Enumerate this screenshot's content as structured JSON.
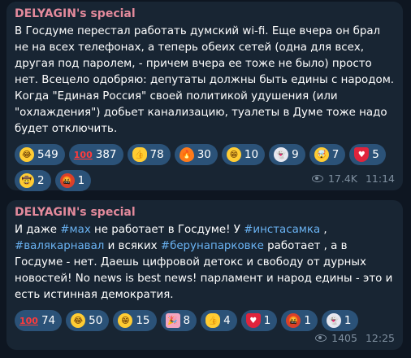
{
  "posts": [
    {
      "channel": "DELYAGIN's special",
      "text": "В Госдуме перестал работать думский wi-fi. Еще вчера он брал не на всех телефонах, а теперь обеих сетей (одна для всех, другая под паролем, - причем вчера ее тоже не было) просто нет. Всецело одобряю: депутаты должны быть едины с народом. Когда \"Единая Россия\" своей политикой удушения (или \"охлаждения\") добьет канализацию, туалеты в Думе тоже надо будет отключить.",
      "reactions": [
        {
          "icon": "rofl-emoji-icon",
          "count": "549"
        },
        {
          "icon": "hundred-emoji-icon",
          "count": "387"
        },
        {
          "icon": "thumbs-up-emoji-icon",
          "count": "78"
        },
        {
          "icon": "fire-emoji-icon",
          "count": "30"
        },
        {
          "icon": "grin-emoji-icon",
          "count": "10"
        },
        {
          "icon": "ghost-emoji-icon",
          "count": "9"
        },
        {
          "icon": "exploding-head-emoji-icon",
          "count": "7"
        },
        {
          "icon": "heart-emoji-icon",
          "count": "5"
        },
        {
          "icon": "cowboy-emoji-icon",
          "count": "2"
        },
        {
          "icon": "cursing-face-emoji-icon",
          "count": "1"
        }
      ],
      "views": "17.4K",
      "time": "11:14"
    },
    {
      "channel": "DELYAGIN's special",
      "text_parts": {
        "p1": "И даже ",
        "h1": "#мах",
        "p2": " не работает в Госдуме! У ",
        "h2": "#инстасамка",
        "p3": " ,",
        "h3": "#валякарнавал",
        "p4": " и всяких ",
        "h4": "#берунапарковке",
        "p5": " работает , а в Госдуме - нет. Даешь цифровой детокс и свободу от дурных новостей! No news is best news! парламент и народ едины - это и есть истинная демократия."
      },
      "reactions": [
        {
          "icon": "hundred-emoji-icon",
          "count": "74"
        },
        {
          "icon": "rofl-emoji-icon",
          "count": "50"
        },
        {
          "icon": "grin-emoji-icon",
          "count": "15"
        },
        {
          "icon": "party-popper-emoji-icon",
          "count": "8"
        },
        {
          "icon": "thumbs-up-emoji-icon",
          "count": "4"
        },
        {
          "icon": "heart-emoji-icon",
          "count": "1"
        },
        {
          "icon": "cursing-face-emoji-icon",
          "count": "1"
        },
        {
          "icon": "ghost-emoji-icon",
          "count": "1"
        }
      ],
      "views": "1405",
      "time": "12:25"
    }
  ],
  "colors": {
    "background": "#0e1621",
    "bubble": "#182533",
    "channel_name": "#e38a9c",
    "hashtag": "#6ab3f3",
    "reaction_pill": "#2b5278",
    "meta": "#7f8f9f"
  }
}
